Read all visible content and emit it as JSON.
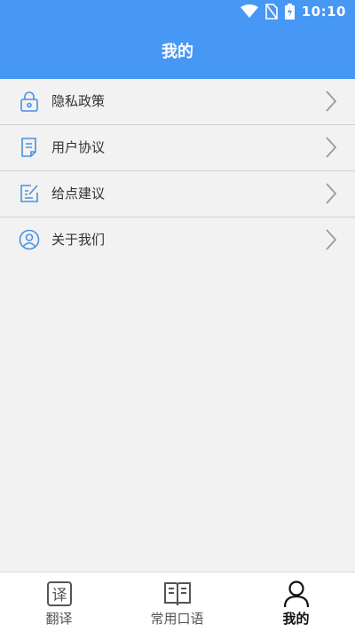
{
  "status_bar": {
    "time": "10:10"
  },
  "header": {
    "title": "我的"
  },
  "menu": {
    "items": [
      {
        "label": "隐私政策",
        "icon": "lock-icon"
      },
      {
        "label": "用户协议",
        "icon": "document-icon"
      },
      {
        "label": "给点建议",
        "icon": "edit-note-icon"
      },
      {
        "label": "关于我们",
        "icon": "user-circle-icon"
      }
    ]
  },
  "tabbar": {
    "tabs": [
      {
        "label": "翻译",
        "icon": "translate-icon",
        "active": false
      },
      {
        "label": "常用口语",
        "icon": "book-icon",
        "active": false
      },
      {
        "label": "我的",
        "icon": "person-icon",
        "active": true
      }
    ]
  },
  "colors": {
    "accent": "#4797f5",
    "icon_blue": "#4a90e2"
  }
}
